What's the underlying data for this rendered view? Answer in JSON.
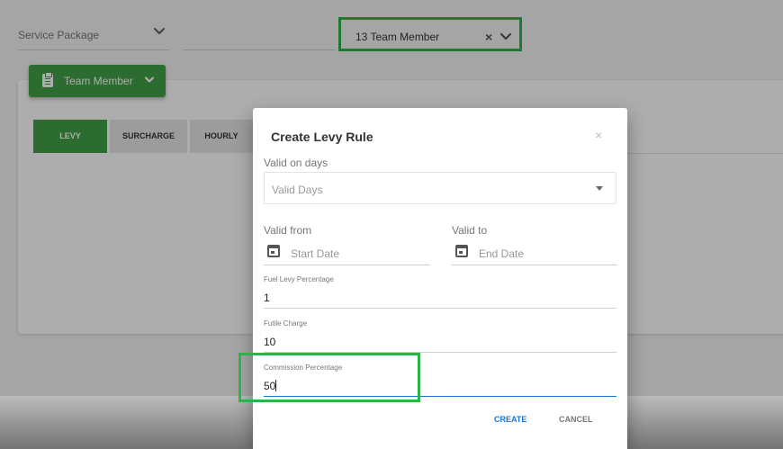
{
  "filters": {
    "service_package_label": "Service Package",
    "team_member_value": "13 Team Member",
    "clear_glyph": "×"
  },
  "team_member_button": {
    "label": "Team Member"
  },
  "tabs": [
    {
      "label": "LEVY"
    },
    {
      "label": "SURCHARGE"
    },
    {
      "label": "HOURLY"
    }
  ],
  "dialog": {
    "title": "Create Levy Rule",
    "close_glyph": "×",
    "valid_on_days": {
      "label": "Valid on days",
      "placeholder": "Valid Days"
    },
    "valid_from": {
      "label": "Valid from",
      "placeholder": "Start Date"
    },
    "valid_to": {
      "label": "Valid to",
      "placeholder": "End Date"
    },
    "fuel_levy": {
      "label": "Fuel Levy Percentage",
      "value": "1"
    },
    "futile_charge": {
      "label": "Futile Charge",
      "value": "10"
    },
    "commission": {
      "label": "Commission Percentage",
      "value": "50"
    },
    "create_label": "CREATE",
    "cancel_label": "CANCEL"
  },
  "colors": {
    "accent_green": "#43a047",
    "highlight_green": "#2db34a",
    "primary_blue": "#1976d2"
  }
}
